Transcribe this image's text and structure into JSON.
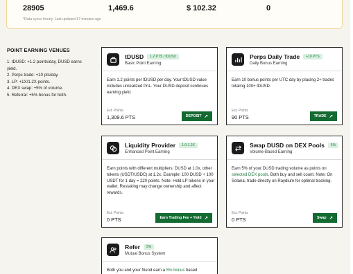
{
  "summary": {
    "stats": [
      "28905",
      "1,469.6",
      "$ 102.32",
      "0"
    ],
    "sync_note": "*Data syncs hourly. Last updated 17 minutes ago"
  },
  "venues": {
    "title": "POINT EARNING VENUES",
    "lines": [
      "1. tDUSD: +1.2 points/day, DUSD earns",
      "yield.",
      "2. Perps trade: +10 pts/day.",
      "3. LP: +1X/1.2X points.",
      "4. DEX swap: +5% of volume.",
      "5. Referral: +5% bonus for both."
    ]
  },
  "cards": {
    "tdusd": {
      "title": "tDUSD",
      "badge": "1.2 PTS / tDUSD",
      "subtitle": "Basic Point Earning",
      "desc": "Earn 1.2 points per tDUSD per day. Your tDUSD value includes unrealized PnL. Your DUSD deposit continues earning yield.",
      "est_label": "Est. Points",
      "est_value": "1,309.6 PTS",
      "action": "DEPOSIT",
      "icon": "token-icon"
    },
    "perps": {
      "title": "Perps Daily Trade",
      "badge": "+10 PTS",
      "subtitle": "Daily Bonus Earning",
      "desc": "Earn 10 bonus points per UTC day by placing 2+ trades totaling 100+ tDUSD.",
      "est_label": "Est. Points",
      "est_value": "90 PTS",
      "action": "TRADE",
      "icon": "chart-icon"
    },
    "liquidity": {
      "title": "Liquidity Provider",
      "badge": "1.0-1.2X",
      "subtitle": "Enhanced Point Earning",
      "desc": "Earn points with different multipliers: DUSD at 1.0x, other tokens (USDT/USDC) at 1.2x. Example: 100 DUSD + 100 USDT for 1 day = 220 points. Note: Hold LP tokens in your wallet. Restaking may change ownership and affect rewards.",
      "est_label": "Est. Points",
      "est_value": "0 PTS",
      "action": "Earn Trading Fee + Yield",
      "icon": "coins-icon"
    },
    "swap": {
      "title": "Swap DUSD on DEX Pools",
      "badge": "5%",
      "subtitle": "Volume-Based Earning",
      "desc_pre": "Earn 5% of your DUSD trading volume as points on ",
      "desc_link": "selected DEX pools",
      "desc_post": ". Both buy and sell count. Note: On Solana, trade directly on Raydium for optimal tracking.",
      "est_label": "Est. Points",
      "est_value": "0 PTS",
      "action": "Swap",
      "icon": "swap-icon"
    },
    "refer": {
      "title": "Refer",
      "badge": "5%",
      "subtitle": "Mutual Bonus System",
      "desc_pre": "Both you and your friend earn a ",
      "desc_link": "5% bonus",
      "desc_post": " based",
      "icon": "users-icon"
    }
  },
  "colors": {
    "accent_green": "#136b32",
    "badge_bg": "#d9efdf",
    "summary_border": "#f0d79a"
  }
}
